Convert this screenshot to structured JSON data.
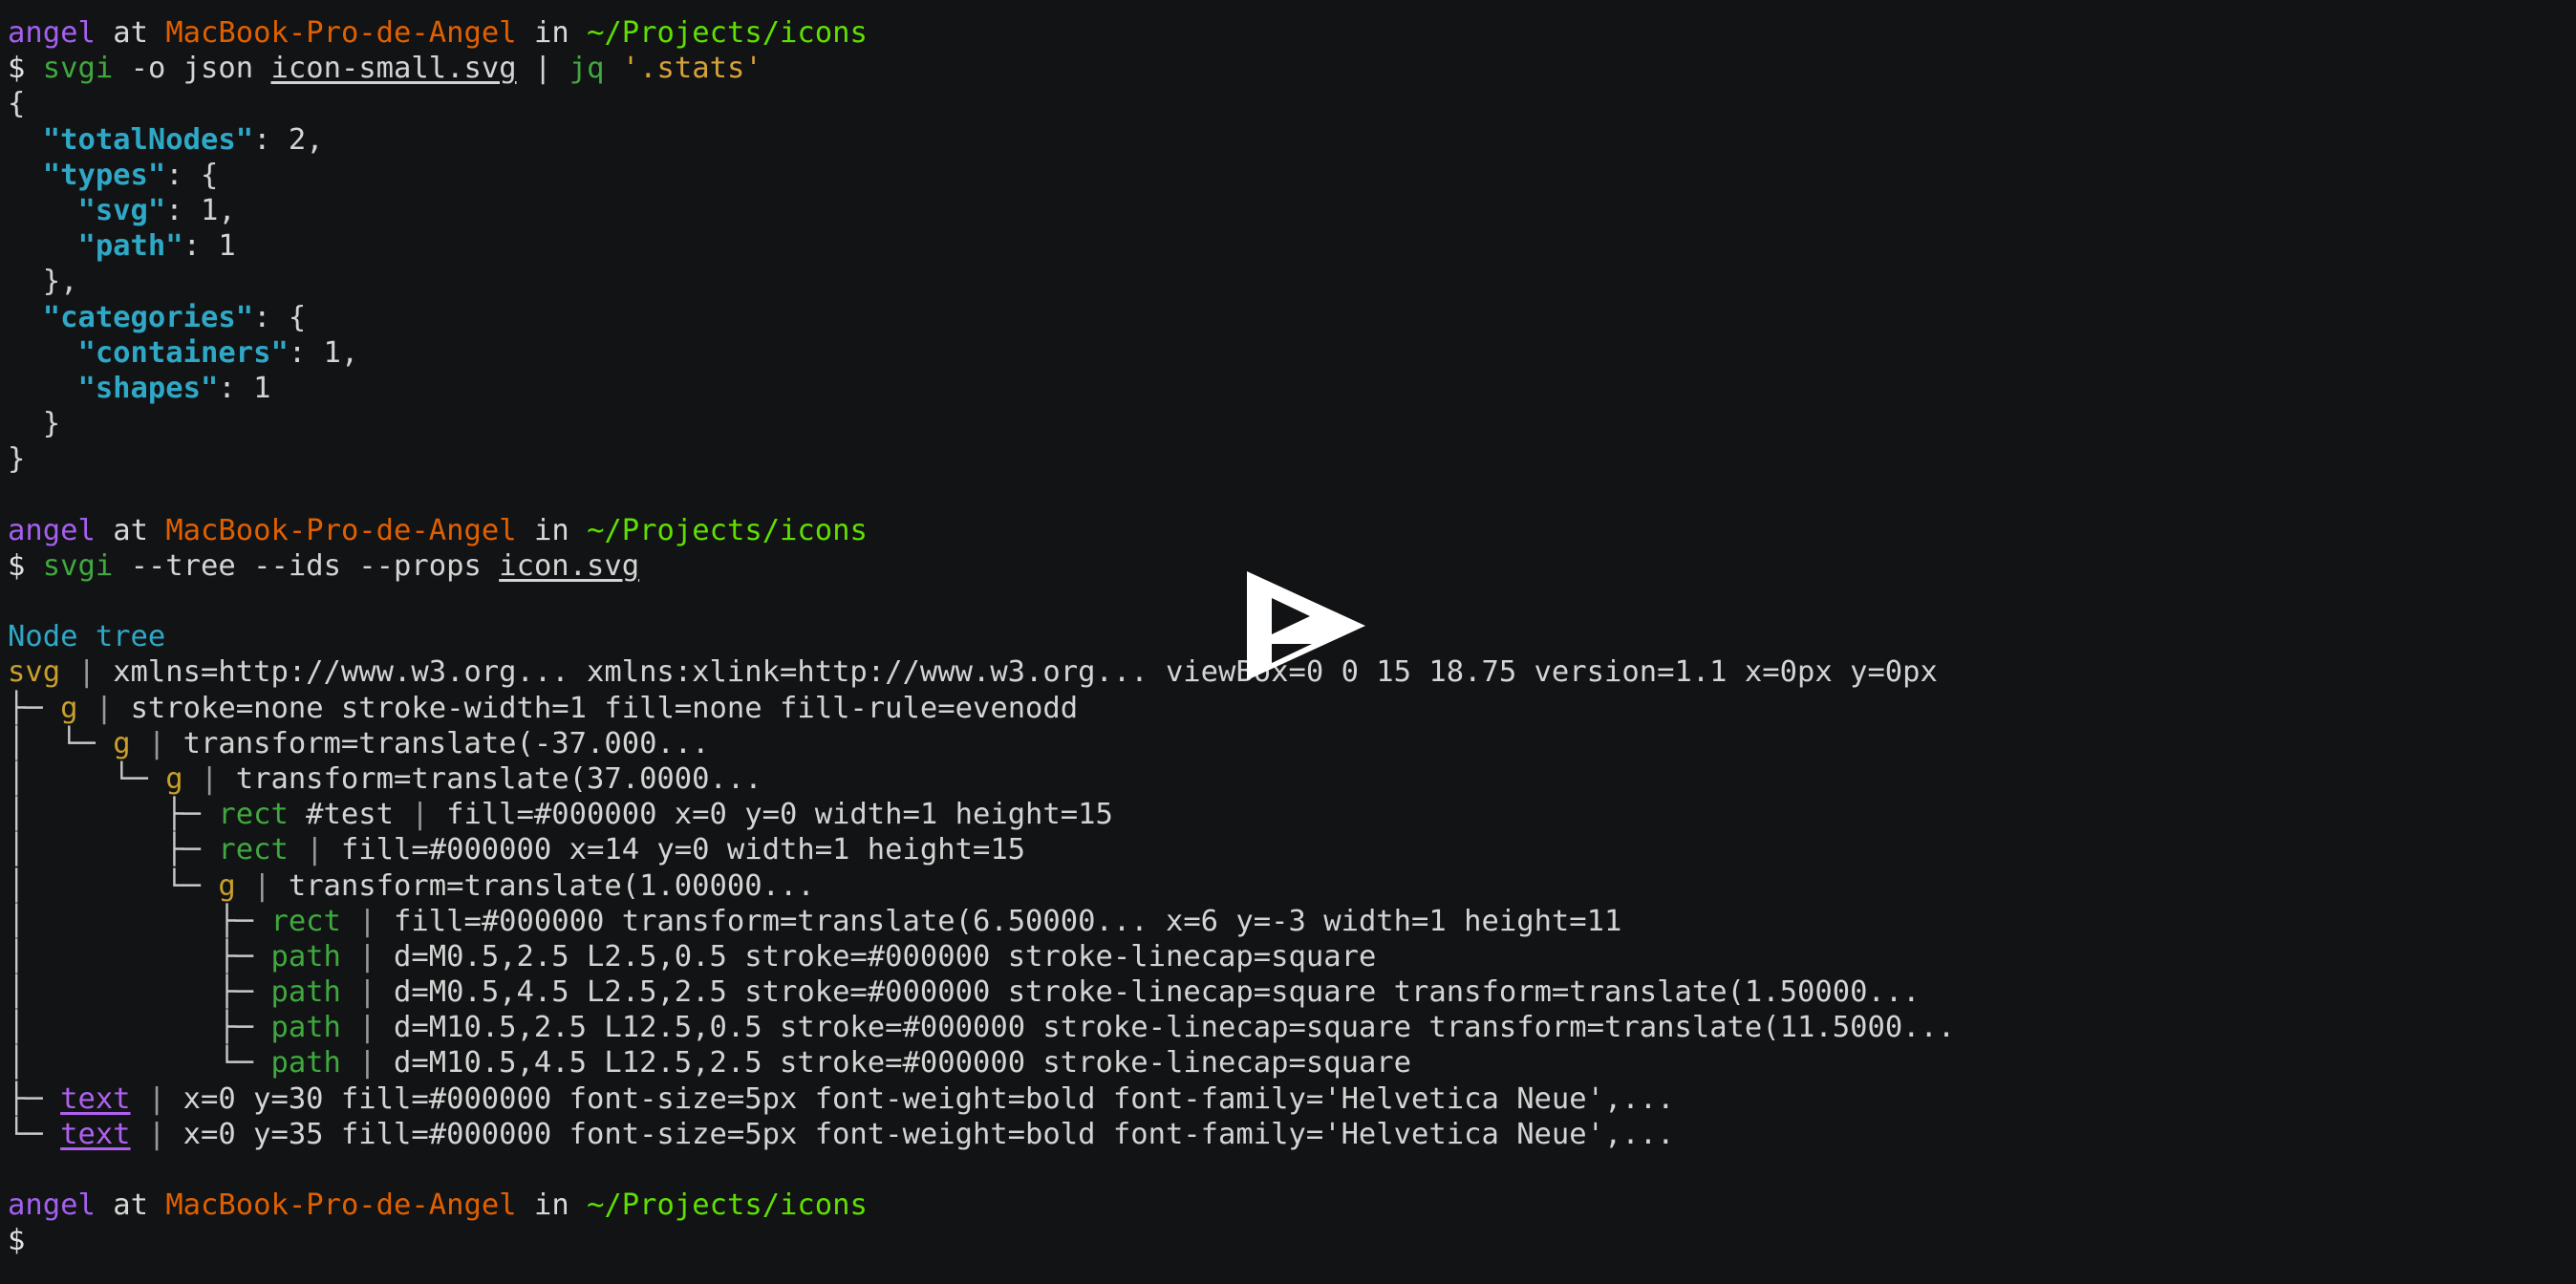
{
  "terminal": {
    "background": "#121314",
    "foreground": "#d4d4d4",
    "prompt_symbol": "$",
    "colors": {
      "user": "#a45ff0",
      "host": "#e06000",
      "path": "#5fe000",
      "command": "#3fa93f",
      "string": "#d7a13b",
      "json_key": "#2fa8c7",
      "heading": "#2fa8c7",
      "tag_container": "#c8a02a",
      "tag_shape": "#3fa93f",
      "tag_text": "#b060f0"
    },
    "prompt": {
      "user": "angel",
      "at": "at",
      "host": "MacBook-Pro-de-Angel",
      "in": "in",
      "path": "~/Projects/icons"
    },
    "blocks": [
      {
        "id": "block-1",
        "command": {
          "name": "svgi",
          "args": "-o json",
          "file": "icon-small.svg",
          "pipe": "|",
          "pipe_cmd": "jq",
          "pipe_arg": "'.stats'"
        },
        "json_output": [
          {
            "indent": 0,
            "punct": "{"
          },
          {
            "indent": 1,
            "key": "\"totalNodes\"",
            "colon": ": ",
            "value": "2,"
          },
          {
            "indent": 1,
            "key": "\"types\"",
            "colon": ": ",
            "value": "{"
          },
          {
            "indent": 2,
            "key": "\"svg\"",
            "colon": ": ",
            "value": "1,"
          },
          {
            "indent": 2,
            "key": "\"path\"",
            "colon": ": ",
            "value": "1"
          },
          {
            "indent": 1,
            "punct": "},"
          },
          {
            "indent": 1,
            "key": "\"categories\"",
            "colon": ": ",
            "value": "{"
          },
          {
            "indent": 2,
            "key": "\"containers\"",
            "colon": ": ",
            "value": "1,"
          },
          {
            "indent": 2,
            "key": "\"shapes\"",
            "colon": ": ",
            "value": "1"
          },
          {
            "indent": 1,
            "punct": "}"
          },
          {
            "indent": 0,
            "punct": "}"
          }
        ]
      },
      {
        "id": "block-2",
        "command": {
          "name": "svgi",
          "args": "--tree --ids --props",
          "file": "icon.svg"
        },
        "heading": "Node tree",
        "tree": [
          {
            "branch": "",
            "tag": "svg",
            "tag_class": "c-tag-svg",
            "id": "",
            "sep": " | ",
            "attrs": "xmlns=http://www.w3.org... xmlns:xlink=http://www.w3.org... viewBox=0 0 15 18.75 version=1.1 x=0px y=0px"
          },
          {
            "branch": "├─ ",
            "tag": "g",
            "tag_class": "c-tag-g",
            "id": "",
            "sep": " | ",
            "attrs": "stroke=none stroke-width=1 fill=none fill-rule=evenodd"
          },
          {
            "branch": "│  └─ ",
            "tag": "g",
            "tag_class": "c-tag-g",
            "id": "",
            "sep": " | ",
            "attrs": "transform=translate(-37.000..."
          },
          {
            "branch": "│     └─ ",
            "tag": "g",
            "tag_class": "c-tag-g",
            "id": "",
            "sep": " | ",
            "attrs": "transform=translate(37.0000..."
          },
          {
            "branch": "│        ├─ ",
            "tag": "rect",
            "tag_class": "c-tag-rect",
            "id": " #test",
            "sep": " | ",
            "attrs": "fill=#000000 x=0 y=0 width=1 height=15"
          },
          {
            "branch": "│        ├─ ",
            "tag": "rect",
            "tag_class": "c-tag-rect",
            "id": "",
            "sep": " | ",
            "attrs": "fill=#000000 x=14 y=0 width=1 height=15"
          },
          {
            "branch": "│        └─ ",
            "tag": "g",
            "tag_class": "c-tag-g",
            "id": "",
            "sep": " | ",
            "attrs": "transform=translate(1.00000..."
          },
          {
            "branch": "│           ├─ ",
            "tag": "rect",
            "tag_class": "c-tag-rect",
            "id": "",
            "sep": " | ",
            "attrs": "fill=#000000 transform=translate(6.50000... x=6 y=-3 width=1 height=11"
          },
          {
            "branch": "│           ├─ ",
            "tag": "path",
            "tag_class": "c-tag-path",
            "id": "",
            "sep": " | ",
            "attrs": "d=M0.5,2.5 L2.5,0.5 stroke=#000000 stroke-linecap=square"
          },
          {
            "branch": "│           ├─ ",
            "tag": "path",
            "tag_class": "c-tag-path",
            "id": "",
            "sep": " | ",
            "attrs": "d=M0.5,4.5 L2.5,2.5 stroke=#000000 stroke-linecap=square transform=translate(1.50000..."
          },
          {
            "branch": "│           ├─ ",
            "tag": "path",
            "tag_class": "c-tag-path",
            "id": "",
            "sep": " | ",
            "attrs": "d=M10.5,2.5 L12.5,0.5 stroke=#000000 stroke-linecap=square transform=translate(11.5000..."
          },
          {
            "branch": "│           └─ ",
            "tag": "path",
            "tag_class": "c-tag-path",
            "id": "",
            "sep": " | ",
            "attrs": "d=M10.5,4.5 L12.5,2.5 stroke=#000000 stroke-linecap=square"
          },
          {
            "branch": "├─ ",
            "tag": "text",
            "tag_class": "c-tag-text",
            "id": "",
            "sep": " | ",
            "attrs": "x=0 y=30 fill=#000000 font-size=5px font-weight=bold font-family='Helvetica Neue',..."
          },
          {
            "branch": "└─ ",
            "tag": "text",
            "tag_class": "c-tag-text",
            "id": "",
            "sep": " | ",
            "attrs": "x=0 y=35 fill=#000000 font-size=5px font-weight=bold font-family='Helvetica Neue',..."
          }
        ]
      },
      {
        "id": "block-3",
        "command": {
          "name": "",
          "args": "",
          "file": ""
        }
      }
    ]
  },
  "overlay": {
    "play_button": {
      "icon": "play-icon",
      "color": "#ffffff"
    }
  }
}
